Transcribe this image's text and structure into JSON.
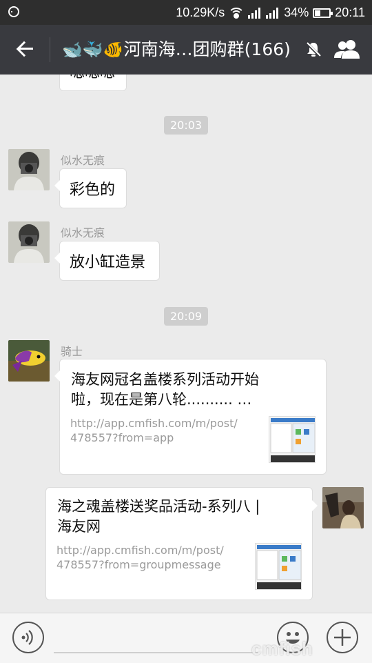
{
  "status_bar": {
    "speed": "10.29K/s",
    "battery": "34%",
    "time": "20:11",
    "icons": [
      "menu-dots-icon",
      "wifi-icon",
      "signal-icon",
      "signal-icon",
      "battery-icon"
    ]
  },
  "header": {
    "emojis": "🐋🐳🐠",
    "title": "河南海…团购群(166)",
    "icons": [
      "back-arrow-icon",
      "mute-bell-icon",
      "group-members-icon"
    ]
  },
  "chat": {
    "partial_bubble_text": "嗯嗯嗯",
    "timestamps": [
      "20:03",
      "20:09"
    ],
    "messages": [
      {
        "sender": "似水无痕",
        "text": "彩色的"
      },
      {
        "sender": "似水无痕",
        "text": "放小缸造景"
      }
    ],
    "link_card_1": {
      "sender": "骑士",
      "title": "海友网冠名盖楼系列活动开始啦，现在是第八轮……….",
      "title_line1": "海友网冠名盖楼系列活动开始",
      "title_line2": "啦，现在是第八轮.......... …",
      "url_line1": "http://app.cmfish.com/m/post/",
      "url_line2": "478557?from=app"
    },
    "link_card_2": {
      "title_line1": "海之魂盖楼送奖品活动-系列八 |",
      "title_line2": "海友网",
      "url_line1": "http://app.cmfish.com/m/post/",
      "url_line2": "478557?from=groupmessage"
    }
  },
  "bottom_bar": {
    "icons": [
      "voice-icon",
      "emoji-icon",
      "plus-icon"
    ]
  },
  "watermark": "cmfish",
  "colors": {
    "status_bg": "#2e2e2e",
    "header_bg": "#393a3f",
    "chat_bg": "#ebebeb",
    "bubble_bg": "#ffffff"
  }
}
